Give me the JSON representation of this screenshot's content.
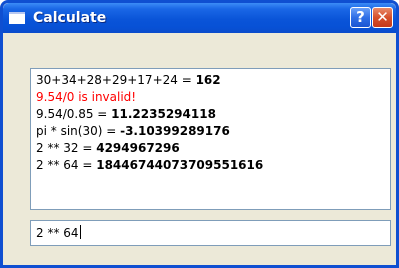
{
  "window": {
    "title": "Calculate",
    "help_label": "?",
    "close_label": "✕",
    "accent_color": "#0a54d8",
    "close_color": "#d6502c"
  },
  "output": {
    "lines": [
      {
        "expr": "30+34+28+29+17+24 = ",
        "result": "162"
      },
      {
        "error": "9.54/0 is invalid!"
      },
      {
        "expr": "9.54/0.85 = ",
        "result": "11.2235294118"
      },
      {
        "expr": "pi * sin(30) = ",
        "result": "-3.10399289176"
      },
      {
        "expr": "2 ** 32 = ",
        "result": "4294967296"
      },
      {
        "expr": "2 ** 64 = ",
        "result": "18446744073709551616"
      }
    ],
    "error_color": "#ff0000"
  },
  "input": {
    "value": "2 ** 64"
  }
}
